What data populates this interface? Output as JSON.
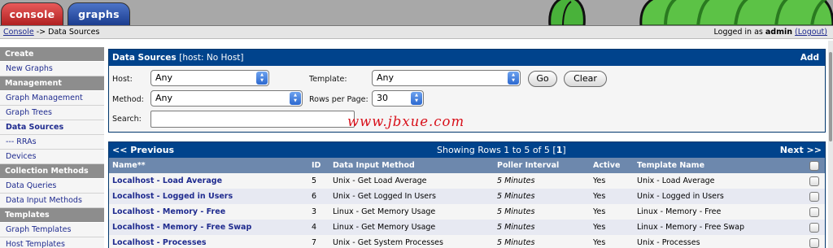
{
  "tabs": {
    "console": "console",
    "graphs": "graphs"
  },
  "breadcrumb": {
    "link": "Console",
    "sep": " -> ",
    "current": "Data Sources"
  },
  "login": {
    "prefix": "Logged in as ",
    "user": "admin",
    "logout": "(Logout)"
  },
  "sidebar": {
    "create_head": "Create",
    "new_graphs": "New Graphs",
    "management_head": "Management",
    "graph_management": "Graph Management",
    "graph_trees": "Graph Trees",
    "data_sources": "Data Sources",
    "rras": "--- RRAs",
    "devices": "Devices",
    "collection_head": "Collection Methods",
    "data_queries": "Data Queries",
    "data_input_methods": "Data Input Methods",
    "templates_head": "Templates",
    "graph_templates": "Graph Templates",
    "host_templates": "Host Templates"
  },
  "panel": {
    "title": "Data Sources",
    "host_note": "[host: No Host]",
    "add": "Add"
  },
  "filter": {
    "host_label": "Host:",
    "host_value": "Any",
    "template_label": "Template:",
    "template_value": "Any",
    "go": "Go",
    "clear": "Clear",
    "method_label": "Method:",
    "method_value": "Any",
    "rows_label": "Rows per Page:",
    "rows_value": "30",
    "search_label": "Search:",
    "search_value": ""
  },
  "watermark": "www.jbxue.com",
  "results": {
    "prev": "<< Previous",
    "showing": "Showing Rows 1 to 5 of 5 [",
    "page": "1",
    "showing_end": "]",
    "next": "Next >>",
    "columns": [
      "Name**",
      "ID",
      "Data Input Method",
      "Poller Interval",
      "Active",
      "Template Name"
    ],
    "rows": [
      {
        "name": "Localhost - Load Average",
        "id": "5",
        "method": "Unix - Get Load Average",
        "interval": "5 Minutes",
        "active": "Yes",
        "template": "Unix - Load Average"
      },
      {
        "name": "Localhost - Logged in Users",
        "id": "6",
        "method": "Unix - Get Logged In Users",
        "interval": "5 Minutes",
        "active": "Yes",
        "template": "Unix - Logged in Users"
      },
      {
        "name": "Localhost - Memory - Free",
        "id": "3",
        "method": "Linux - Get Memory Usage",
        "interval": "5 Minutes",
        "active": "Yes",
        "template": "Linux - Memory - Free"
      },
      {
        "name": "Localhost - Memory - Free Swap",
        "id": "4",
        "method": "Linux - Get Memory Usage",
        "interval": "5 Minutes",
        "active": "Yes",
        "template": "Linux - Memory - Free Swap"
      },
      {
        "name": "Localhost - Processes",
        "id": "7",
        "method": "Unix - Get System Processes",
        "interval": "5 Minutes",
        "active": "Yes",
        "template": "Unix - Processes"
      }
    ]
  }
}
